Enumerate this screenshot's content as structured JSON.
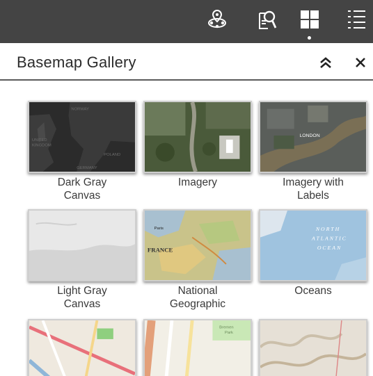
{
  "toolbar": {
    "buttons": [
      {
        "id": "layers",
        "icon": "map-pin-layers-icon"
      },
      {
        "id": "query",
        "icon": "document-search-icon"
      },
      {
        "id": "basemap",
        "icon": "grid-four-squares-icon",
        "active": true
      },
      {
        "id": "legend",
        "icon": "list-icon"
      }
    ]
  },
  "panel": {
    "title": "Basemap Gallery",
    "collapse_icon": "double-chevron-up-icon",
    "close_icon": "close-icon"
  },
  "gallery": {
    "items": [
      {
        "label": "Dark Gray\nCanvas",
        "thumbnail": "dark-gray-canvas"
      },
      {
        "label": "Imagery",
        "thumbnail": "imagery"
      },
      {
        "label": "Imagery with\nLabels",
        "thumbnail": "imagery-with-labels"
      },
      {
        "label": "Light Gray\nCanvas",
        "thumbnail": "light-gray-canvas"
      },
      {
        "label": "National\nGeographic",
        "thumbnail": "national-geographic"
      },
      {
        "label": "Oceans",
        "thumbnail": "oceans"
      },
      {
        "label": "",
        "thumbnail": "streets"
      },
      {
        "label": "",
        "thumbnail": "openstreetmap"
      },
      {
        "label": "",
        "thumbnail": "terrain"
      }
    ]
  },
  "thumbnail_text": {
    "dark_gray": [
      "NORWAY",
      "UNITED",
      "KINGDOM",
      "POLAND",
      "GERMANY"
    ],
    "imagery_labels": [
      "LONDON"
    ],
    "national_geographic": [
      "FRANCE",
      "Paris"
    ],
    "oceans": [
      "NORTH",
      "ATLANTIC",
      "OCEAN"
    ],
    "openstreetmap": [
      "Bremen",
      "Park"
    ]
  }
}
